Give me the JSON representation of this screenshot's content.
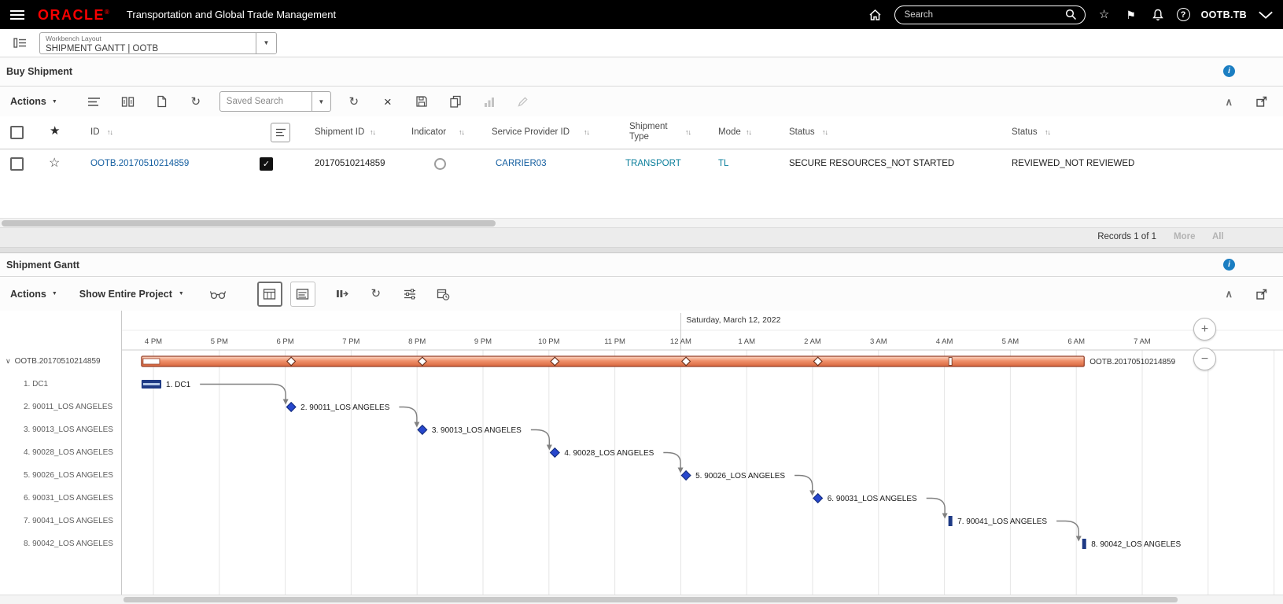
{
  "topbar": {
    "brand": "ORACLE",
    "brand_reg": "®",
    "title": "Transportation and Global Trade Management",
    "search": {
      "placeholder": "Search"
    },
    "username": "OOTB.TB"
  },
  "workbench": {
    "label": "Workbench Layout",
    "value": "SHIPMENT GANTT | OOTB"
  },
  "buy_shipment": {
    "title": "Buy Shipment",
    "toolbar": {
      "actions_label": "Actions",
      "saved_search_value": "Saved Search"
    },
    "table": {
      "columns": {
        "id": "ID",
        "shipment_id": "Shipment ID",
        "indicator": "Indicator",
        "service_provider_id": "Service Provider ID",
        "shipment_type": "Shipment Type",
        "mode": "Mode",
        "status1": "Status",
        "status2": "Status"
      },
      "row": {
        "id": "OOTB.20170510214859",
        "shipment_id": "20170510214859",
        "service_provider_id": "CARRIER03",
        "shipment_type": "TRANSPORT",
        "mode": "TL",
        "status1": "SECURE RESOURCES_NOT STARTED",
        "status2": "REVIEWED_NOT REVIEWED"
      }
    },
    "records_label": "Records 1 of 1",
    "more_label": "More",
    "all_label": "All"
  },
  "gantt": {
    "title": "Shipment Gantt",
    "toolbar": {
      "actions_label": "Actions",
      "show_label": "Show Entire Project"
    },
    "zoom_in": "+",
    "zoom_out": "−"
  },
  "glyphs": {
    "sort": "↑↓",
    "caret_down": "▼",
    "star_filled": "★",
    "star_outline": "☆",
    "check": "✓",
    "collapse": "∧",
    "chevron_down": "∨",
    "flag": "⚑",
    "refresh": "↻",
    "close": "×",
    "help": "?",
    "info": "i"
  },
  "chart_data": {
    "type": "gantt",
    "timeline": {
      "date_label": "Saturday, March 12, 2022",
      "hours": [
        "4 PM",
        "5 PM",
        "6 PM",
        "7 PM",
        "8 PM",
        "9 PM",
        "10 PM",
        "11 PM",
        "12 AM",
        "1 AM",
        "2 AM",
        "3 AM",
        "4 AM",
        "5 AM",
        "6 AM",
        "7 AM"
      ],
      "date_boundary_index": 8,
      "hours_per_pixel_note": "offsets below are hours after 4 PM"
    },
    "summary": {
      "label": "OOTB.20170510214859",
      "start": -0.18,
      "end": 14.12,
      "milestones": [
        2.09,
        4.08,
        6.09,
        8.08,
        10.08
      ],
      "tick": 12.09
    },
    "rows": [
      {
        "label": "1. DC1",
        "type": "bar",
        "start": -0.18,
        "end": 0.12
      },
      {
        "label": "2. 90011_LOS ANGELES",
        "type": "milestone",
        "at": 2.09
      },
      {
        "label": "3. 90013_LOS ANGELES",
        "type": "milestone",
        "at": 4.08
      },
      {
        "label": "4. 90028_LOS ANGELES",
        "type": "milestone",
        "at": 6.09
      },
      {
        "label": "5. 90026_LOS ANGELES",
        "type": "milestone",
        "at": 8.08
      },
      {
        "label": "6. 90031_LOS ANGELES",
        "type": "milestone",
        "at": 10.08
      },
      {
        "label": "7. 90041_LOS ANGELES",
        "type": "smallbar",
        "at": 12.09
      },
      {
        "label": "8. 90042_LOS ANGELES",
        "type": "smallbar",
        "at": 14.12
      }
    ],
    "colors": {
      "summary_fill": "#f0916b",
      "summary_border": "#96412a",
      "milestone_fill": "#2747cd",
      "task_fill": "#1e3a85",
      "connector": "#808080"
    }
  }
}
